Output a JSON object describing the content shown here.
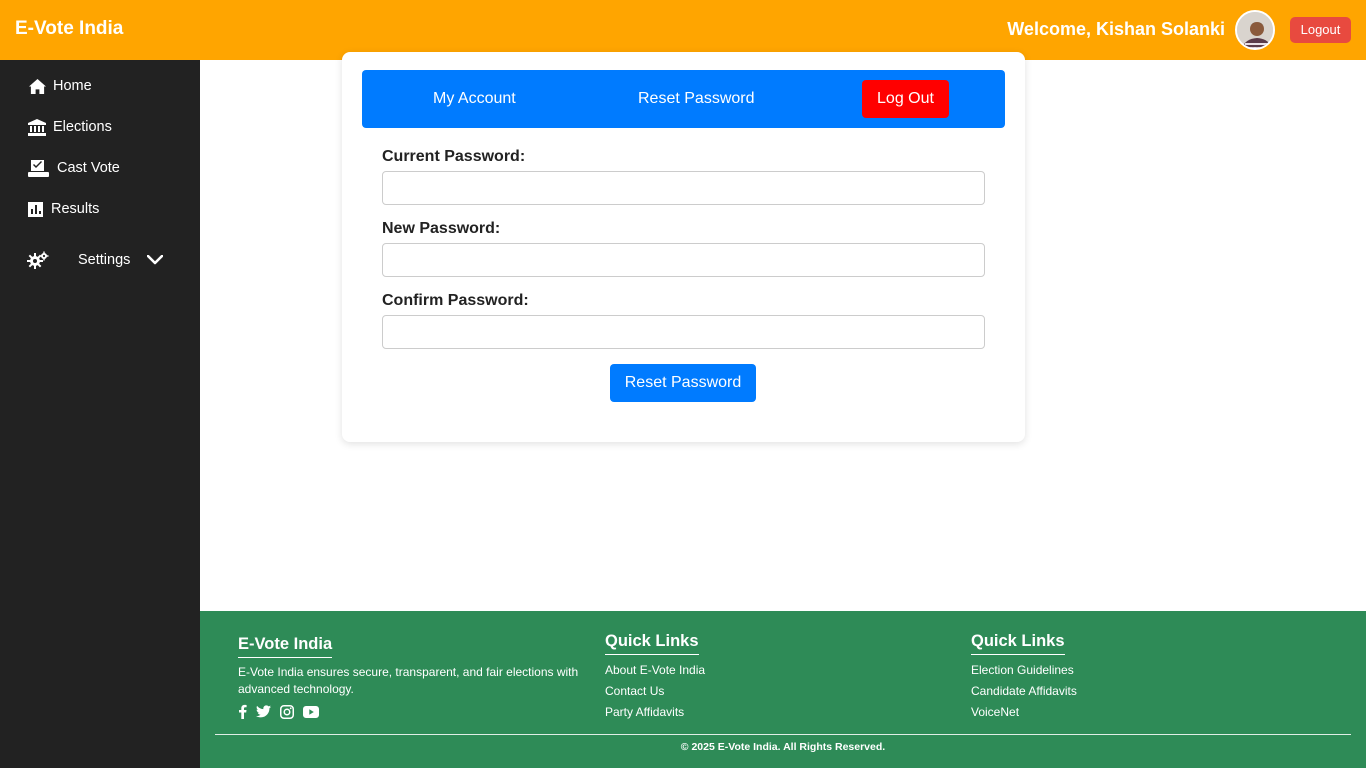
{
  "header": {
    "brand": "E-Vote India",
    "welcome": "Welcome, Kishan Solanki",
    "logout_label": "Logout"
  },
  "sidebar": {
    "items": [
      {
        "label": "Home",
        "icon": "home-icon"
      },
      {
        "label": "Elections",
        "icon": "bank-icon"
      },
      {
        "label": "Cast Vote",
        "icon": "vote-icon"
      },
      {
        "label": "Results",
        "icon": "chart-icon"
      },
      {
        "label": "Settings",
        "icon": "gears-icon"
      }
    ]
  },
  "tabs": {
    "my_account": "My Account",
    "reset_password": "Reset Password",
    "log_out": "Log Out"
  },
  "form": {
    "current_label": "Current Password:",
    "new_label": "New Password:",
    "confirm_label": "Confirm Password:",
    "current_value": "",
    "new_value": "",
    "confirm_value": "",
    "submit_label": "Reset Password"
  },
  "footer": {
    "about_title": "E-Vote India",
    "about_text": "E-Vote India ensures secure, transparent, and fair elections with advanced technology.",
    "links1_title": "Quick Links",
    "links1": [
      "About E-Vote India",
      "Contact Us",
      "Party Affidavits"
    ],
    "links2_title": "Quick Links",
    "links2": [
      "Election Guidelines",
      "Candidate Affidavits",
      "VoiceNet"
    ],
    "copyright": "© 2025 E-Vote India. All Rights Reserved.",
    "socials": [
      "facebook-icon",
      "twitter-icon",
      "instagram-icon",
      "youtube-icon"
    ]
  },
  "colors": {
    "header": "#ffa500",
    "sidebar": "#222222",
    "primary": "#007bff",
    "danger": "#ff0000",
    "footer": "#2e8b57"
  }
}
